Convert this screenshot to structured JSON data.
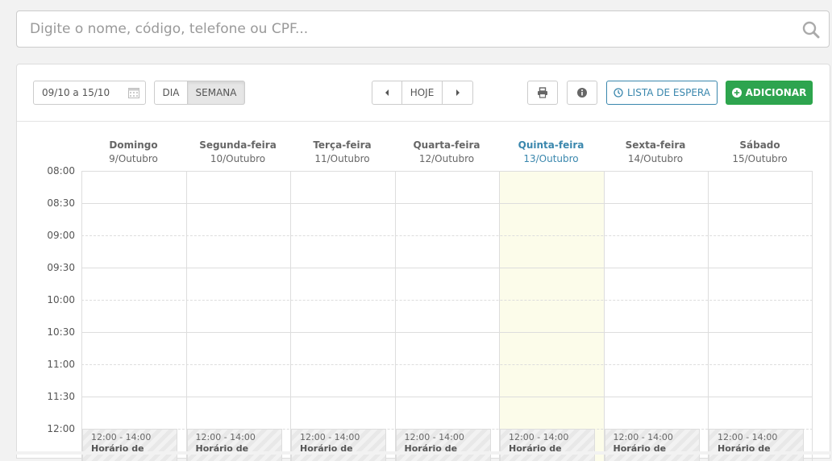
{
  "search": {
    "placeholder": "Digite o nome, código, telefone ou CPF...",
    "icon": "search-icon"
  },
  "toolbar": {
    "date_range": "09/10 a 15/10",
    "view_day_label": "DIA",
    "view_week_label": "SEMANA",
    "active_view": "SEMANA",
    "today_label": "HOJE",
    "waitlist_label": "LISTA DE ESPERA",
    "add_label": "ADICIONAR"
  },
  "colors": {
    "accent": "#3a87ad",
    "add_green": "#2ea44f",
    "today_bg": "#fcfcea"
  },
  "calendar": {
    "days": [
      {
        "name": "Domingo",
        "date": "9/Outubro"
      },
      {
        "name": "Segunda-feira",
        "date": "10/Outubro"
      },
      {
        "name": "Terça-feira",
        "date": "11/Outubro"
      },
      {
        "name": "Quarta-feira",
        "date": "12/Outubro"
      },
      {
        "name": "Quinta-feira",
        "date": "13/Outubro",
        "today": true
      },
      {
        "name": "Sexta-feira",
        "date": "14/Outubro"
      },
      {
        "name": "Sábado",
        "date": "15/Outubro"
      }
    ],
    "times": [
      "08:00",
      "08:30",
      "09:00",
      "09:30",
      "10:00",
      "10:30",
      "11:00",
      "11:30",
      "12:00"
    ],
    "blocks": [
      {
        "time": "12:00 - 14:00",
        "title": "Horário de"
      },
      {
        "time": "12:00 - 14:00",
        "title": "Horário de"
      },
      {
        "time": "12:00 - 14:00",
        "title": "Horário de"
      },
      {
        "time": "12:00 - 14:00",
        "title": "Horário de"
      },
      {
        "time": "12:00 - 14:00",
        "title": "Horário de"
      },
      {
        "time": "12:00 - 14:00",
        "title": "Horário de"
      },
      {
        "time": "12:00 - 14:00",
        "title": "Horário de"
      }
    ]
  }
}
